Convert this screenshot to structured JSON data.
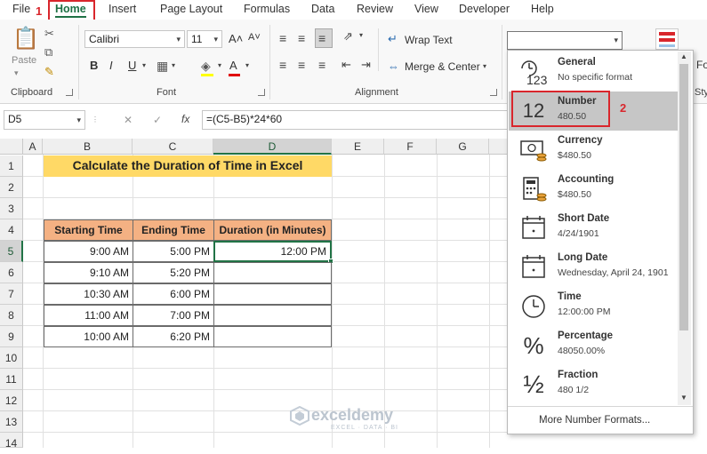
{
  "menu": {
    "tabs": [
      "File",
      "Home",
      "Insert",
      "Page Layout",
      "Formulas",
      "Data",
      "Review",
      "View",
      "Developer",
      "Help"
    ],
    "active_tab": "Home",
    "step1": "1",
    "step2": "2"
  },
  "ribbon": {
    "clipboard_label": "Clipboard",
    "paste_label": "Paste",
    "font_label": "Font",
    "font_name": "Calibri",
    "font_size": "11",
    "grow_font": "A˄",
    "shrink_font": "A˅",
    "bold": "B",
    "italic": "I",
    "underline": "U",
    "font_color": "A",
    "alignment_label": "Alignment",
    "wrap_text": "Wrap Text",
    "merge_center": "Merge & Center",
    "number_format_value": "",
    "fo_text": "Fo",
    "sty_text": "Sty"
  },
  "formula_bar": {
    "name_box": "D5",
    "cancel": "✕",
    "enter": "✓",
    "fx": "fx",
    "formula": "=(C5-B5)*24*60"
  },
  "sheet": {
    "columns": [
      "A",
      "B",
      "C",
      "D",
      "E",
      "F",
      "G"
    ],
    "rows": [
      "1",
      "2",
      "3",
      "4",
      "5",
      "6",
      "7",
      "8",
      "9",
      "10",
      "11",
      "12",
      "13",
      "14"
    ],
    "title": "Calculate the Duration of Time in Excel",
    "headers": [
      "Starting Time",
      "Ending Time",
      "Duration (in Minutes)"
    ],
    "data_rows": [
      [
        "9:00 AM",
        "5:00 PM",
        "12:00 PM"
      ],
      [
        "9:10 AM",
        "5:20 PM",
        ""
      ],
      [
        "10:30 AM",
        "6:00 PM",
        ""
      ],
      [
        "11:00 AM",
        "7:00 PM",
        ""
      ],
      [
        "10:00 AM",
        "6:20 PM",
        ""
      ]
    ]
  },
  "number_formats": {
    "items": [
      {
        "title": "General",
        "sub": "No specific format",
        "icon": "general-icon",
        "glyph": "123"
      },
      {
        "title": "Number",
        "sub": "480.50",
        "icon": "number-icon",
        "glyph": "12"
      },
      {
        "title": "Currency",
        "sub": "$480.50",
        "icon": "currency-icon",
        "glyph": ""
      },
      {
        "title": "Accounting",
        "sub": "$480.50",
        "icon": "accounting-icon",
        "glyph": ""
      },
      {
        "title": "Short Date",
        "sub": "4/24/1901",
        "icon": "short-date-icon",
        "glyph": ""
      },
      {
        "title": "Long Date",
        "sub": "Wednesday, April 24, 1901",
        "icon": "long-date-icon",
        "glyph": ""
      },
      {
        "title": "Time",
        "sub": "12:00:00 PM",
        "icon": "clock-icon",
        "glyph": ""
      },
      {
        "title": "Percentage",
        "sub": "48050.00%",
        "icon": "percent-icon",
        "glyph": "%"
      },
      {
        "title": "Fraction",
        "sub": "480 1/2",
        "icon": "fraction-icon",
        "glyph": "½"
      }
    ],
    "selected": "Number",
    "more": "More Number Formats..."
  },
  "watermark": {
    "name": "exceldemy",
    "tagline": "EXCEL · DATA · BI"
  },
  "colors": {
    "accent": "#217346",
    "header_fill": "#f4b183",
    "title_fill": "#ffd966",
    "highlight_red": "#d9262c"
  }
}
